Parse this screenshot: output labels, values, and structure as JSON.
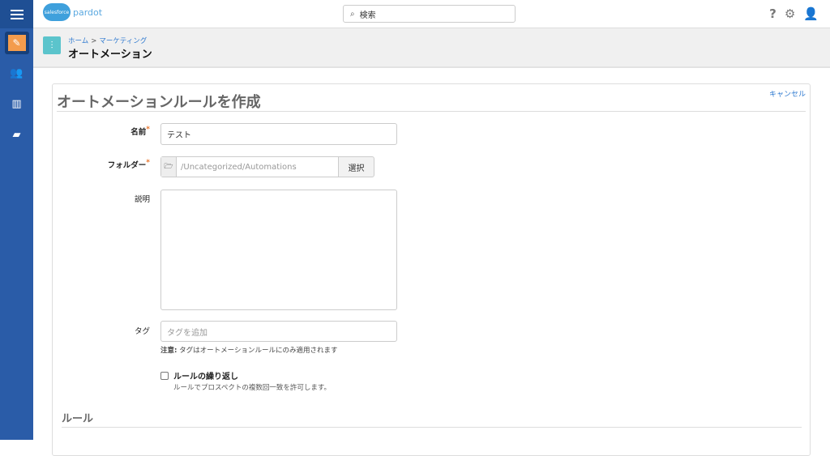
{
  "brand": {
    "cloud": "salesforce",
    "product": "pardot"
  },
  "search": {
    "placeholder": "検索"
  },
  "breadcrumb": {
    "home": "ホーム",
    "sep": ">",
    "marketing": "マーケティング"
  },
  "header": {
    "title": "オートメーション"
  },
  "form": {
    "title": "オートメーションルールを作成",
    "cancel": "キャンセル",
    "name": {
      "label": "名前",
      "required": "*",
      "value": "テスト"
    },
    "folder": {
      "label": "フォルダー",
      "required": "*",
      "value": "/Uncategorized/Automations",
      "button": "選択"
    },
    "description": {
      "label": "説明",
      "value": ""
    },
    "tags": {
      "label": "タグ",
      "placeholder": "タグを追加",
      "note_bold": "注意:",
      "note": " タグはオートメーションルールにのみ適用されます"
    },
    "repeat": {
      "label": "ルールの繰り返し",
      "checked": false,
      "help": "ルールでプロスペクトの複数回一致を許可します。"
    },
    "rules_section": "ルール"
  }
}
